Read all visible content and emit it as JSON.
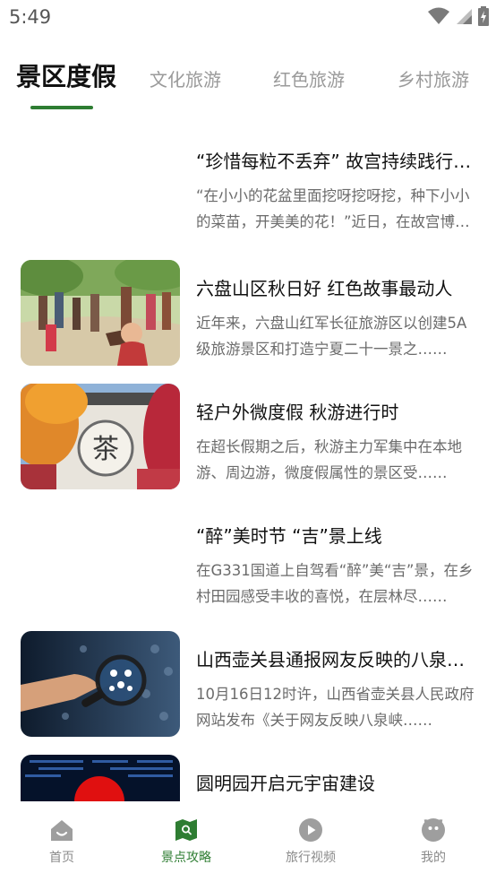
{
  "status_bar": {
    "time": "5:49"
  },
  "tabs": [
    {
      "label": "景区度假"
    },
    {
      "label": "文化旅游"
    },
    {
      "label": "红色旅游"
    },
    {
      "label": "乡村旅游"
    }
  ],
  "articles": [
    {
      "title": "“珍惜每粒不丢弃” 故宫持续践行“光盘行动”",
      "summary": "“在小小的花盆里面挖呀挖呀挖，种下小小的菜苗，开美美的花！”近日，在故宫博物院……",
      "thumbnail": "none"
    },
    {
      "title": "六盘山区秋日好 红色故事最动人",
      "summary": "近年来，六盘山红军长征旅游区以创建5A级旅游景区和打造宁夏二十一景之……",
      "thumbnail": "people-with-statues-photo"
    },
    {
      "title": "轻户外微度假 秋游进行时",
      "summary": "在超长假期之后，秋游主力军集中在本地游、周边游，微度假属性的景区受……",
      "thumbnail": "autumn-tree-wall-photo"
    },
    {
      "title": "“醉”美时节 “吉”景上线",
      "summary": "在G331国道上自驾看“醉”美“吉”景，在乡村田园感受丰收的喜悦，在层林尽……",
      "thumbnail": "none"
    },
    {
      "title": "山西壶关县通报网友反映的八泉峡景区问题",
      "summary": "10月16日12时许，山西省壶关县人民政府网站发布《关于网友反映八泉峡……",
      "thumbnail": "magnifier-network-photo"
    },
    {
      "title": "圆明园开启元宇宙建设",
      "summary": "",
      "thumbnail": "digital-tech-photo"
    }
  ],
  "bottom_nav": [
    {
      "label": "首页",
      "icon": "home-icon"
    },
    {
      "label": "景点攻略",
      "icon": "map-search-icon"
    },
    {
      "label": "旅行视频",
      "icon": "play-icon"
    },
    {
      "label": "我的",
      "icon": "profile-face-icon"
    }
  ],
  "colors": {
    "accent": "#2e7d32",
    "inactive": "#9a9a9a",
    "summary_text": "#6b6b6b"
  }
}
